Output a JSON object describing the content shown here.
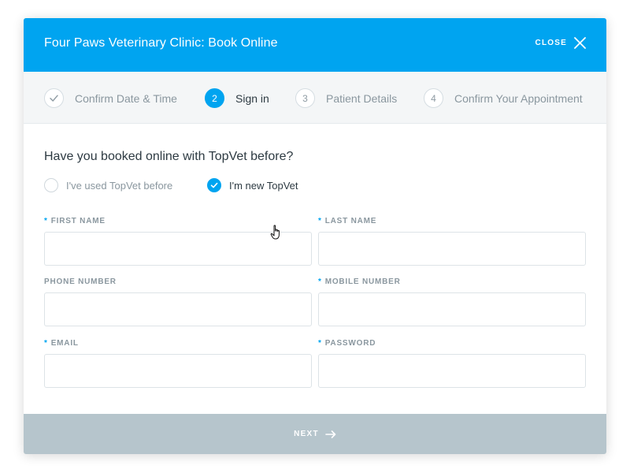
{
  "header": {
    "title": "Four Paws Veterinary Clinic: Book Online",
    "close_label": "CLOSE",
    "close_icon": "close-icon",
    "background_color": "#00a4f0"
  },
  "steps": [
    {
      "number": "",
      "label": "Confirm Date & Time",
      "state": "completed",
      "icon": "check-icon"
    },
    {
      "number": "2",
      "label": "Sign in",
      "state": "active"
    },
    {
      "number": "3",
      "label": "Patient Details",
      "state": "upcoming"
    },
    {
      "number": "4",
      "label": "Confirm Your Appointment",
      "state": "upcoming"
    }
  ],
  "form": {
    "question": "Have you booked online with TopVet before?",
    "options": [
      {
        "label": "I've used TopVet before",
        "checked": false
      },
      {
        "label": "I'm new TopVet",
        "checked": true
      }
    ],
    "required_marker": "*",
    "fields": {
      "first_name": {
        "label": "FIRST NAME",
        "required": true,
        "value": ""
      },
      "last_name": {
        "label": "LAST NAME",
        "required": true,
        "value": ""
      },
      "phone_number": {
        "label": "PHONE NUMBER",
        "required": false,
        "value": ""
      },
      "mobile_number": {
        "label": "MOBILE NUMBER",
        "required": true,
        "value": ""
      },
      "email": {
        "label": "EMAIL",
        "required": true,
        "value": ""
      },
      "password": {
        "label": "PASSWORD",
        "required": true,
        "value": ""
      }
    }
  },
  "footer": {
    "next_label": "NEXT",
    "next_icon": "arrow-right-icon",
    "background_color": "#b6c5cc"
  }
}
